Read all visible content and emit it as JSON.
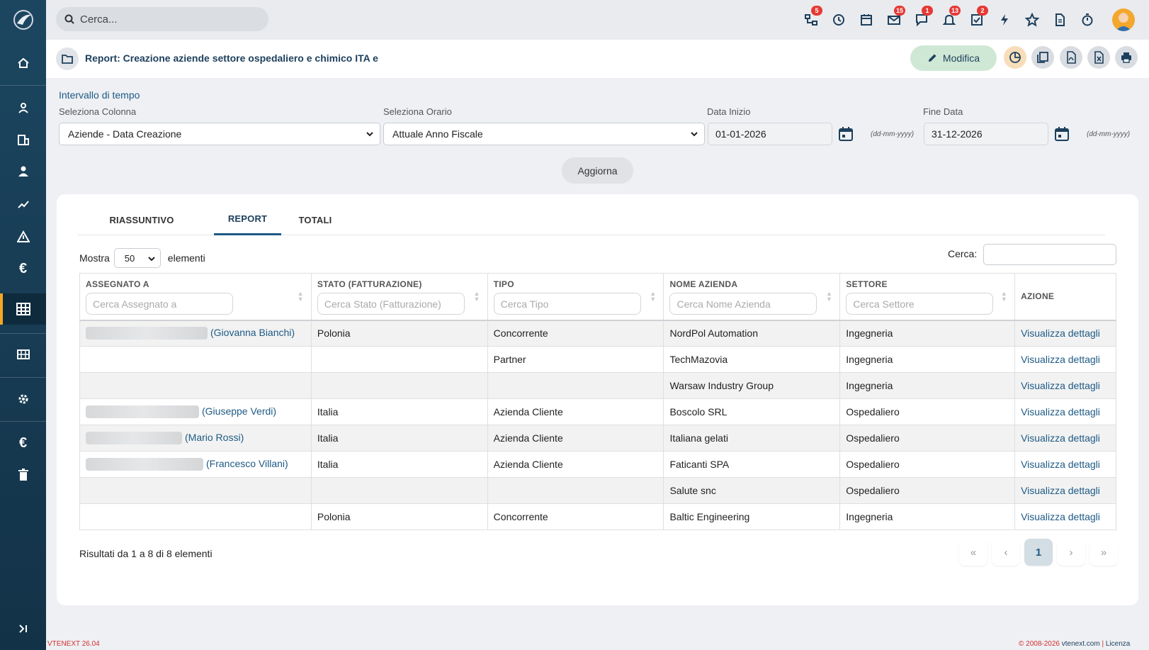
{
  "search": {
    "placeholder": "Cerca..."
  },
  "topbar_badges": {
    "tree": "5",
    "mail": "15",
    "chat": "1",
    "bell": "13",
    "tasks": "2"
  },
  "header": {
    "title": "Report: Creazione aziende settore ospedaliero e chimico ITA e",
    "edit_label": "Modifica"
  },
  "filters": {
    "title": "Intervallo di tempo",
    "column_label": "Seleziona Colonna",
    "column_value": "Aziende - Data Creazione",
    "time_label": "Seleziona Orario",
    "time_value": "Attuale Anno Fiscale",
    "start_label": "Data Inizio",
    "start_value": "01-01-2026",
    "end_label": "Fine Data",
    "end_value": "31-12-2026",
    "date_format": "(dd-mm-yyyy)",
    "refresh_label": "Aggiorna"
  },
  "tabs": [
    "RIASSUNTIVO",
    "REPORT",
    "TOTALI"
  ],
  "table_controls": {
    "show_label": "Mostra",
    "page_length": "50",
    "elements_label": "elementi",
    "search_label": "Cerca:"
  },
  "table": {
    "columns": [
      {
        "label": "ASSEGNATO A",
        "placeholder": "Cerca Assegnato a"
      },
      {
        "label": "STATO (FATTURAZIONE)",
        "placeholder": "Cerca Stato (Fatturazione)"
      },
      {
        "label": "TIPO",
        "placeholder": "Cerca Tipo"
      },
      {
        "label": "NOME AZIENDA",
        "placeholder": "Cerca Nome Azienda"
      },
      {
        "label": "SETTORE",
        "placeholder": "Cerca Settore"
      },
      {
        "label": "AZIONE",
        "placeholder": ""
      }
    ],
    "rows": [
      {
        "assignee": "(Giovanna Bianchi)",
        "stato": "Polonia",
        "tipo": "Concorrente",
        "nome": "NordPol Automation",
        "settore": "Ingegneria",
        "azione": "Visualizza dettagli"
      },
      {
        "assignee": "",
        "stato": "",
        "tipo": "Partner",
        "nome": "TechMazovia",
        "settore": "Ingegneria",
        "azione": "Visualizza dettagli"
      },
      {
        "assignee": "",
        "stato": "",
        "tipo": "",
        "nome": "Warsaw Industry Group",
        "settore": "Ingegneria",
        "azione": "Visualizza dettagli"
      },
      {
        "assignee": "(Giuseppe Verdi)",
        "stato": "Italia",
        "tipo": "Azienda Cliente",
        "nome": "Boscolo SRL",
        "settore": "Ospedaliero",
        "azione": "Visualizza dettagli"
      },
      {
        "assignee": "(Mario Rossi)",
        "stato": "Italia",
        "tipo": "Azienda Cliente",
        "nome": "Italiana gelati",
        "settore": "Ospedaliero",
        "azione": "Visualizza dettagli"
      },
      {
        "assignee": "(Francesco Villani)",
        "stato": "Italia",
        "tipo": "Azienda Cliente",
        "nome": "Faticanti SPA",
        "settore": "Ospedaliero",
        "azione": "Visualizza dettagli"
      },
      {
        "assignee": "",
        "stato": "",
        "tipo": "",
        "nome": "Salute snc",
        "settore": "Ospedaliero",
        "azione": "Visualizza dettagli"
      },
      {
        "assignee": "",
        "stato": "Polonia",
        "tipo": "Concorrente",
        "nome": "Baltic Engineering",
        "settore": "Ingegneria",
        "azione": "Visualizza dettagli"
      }
    ]
  },
  "pagination": {
    "summary": "Risultati da 1 a 8 di 8 elementi",
    "first": "«",
    "prev": "‹",
    "current": "1",
    "next": "›",
    "last": "»"
  },
  "footer": {
    "version": "VTENEXT 26.04",
    "copyright": "© 2008-2026",
    "site": "vtenext.com",
    "separator": "|",
    "license": "Licenza"
  },
  "colors": {
    "accent": "#1d5a85",
    "sidebar": "#1c4660",
    "active_marker": "#f5a623",
    "badge": "#e53935",
    "edit_button": "#cfe8d5"
  }
}
